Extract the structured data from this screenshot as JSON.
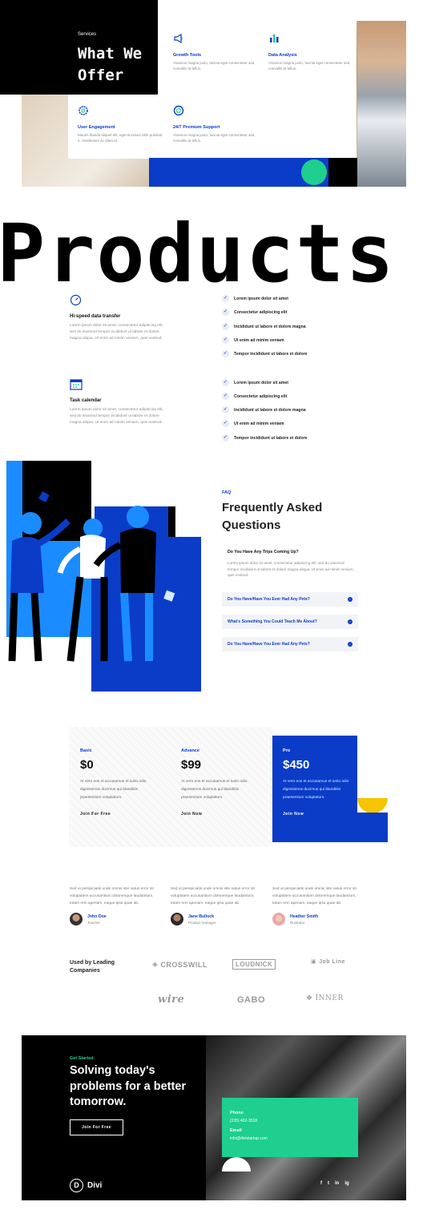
{
  "services": {
    "label": "Services",
    "title_line1": "What We",
    "title_line2": "Offer",
    "features": [
      {
        "title": "Growth Tools",
        "text": "Vivamus magna justo, lacinia eget consectetur sed, convallis at tellus.",
        "icon": "megaphone-icon"
      },
      {
        "title": "Data Analysis",
        "text": "Vivamus magna justo, lacinia eget consectetur sed, convallis at tellus.",
        "icon": "bar-chart-icon"
      },
      {
        "title": "User Engagement",
        "text": "Mauris blandit aliquet elit, eget tincidunt nibh pulvinar a. Vestibulum ac diam et.",
        "icon": "gear-icon"
      },
      {
        "title": "24/7 Premium Support",
        "text": "Vivamus magna justo, lacinia eget consectetur sed, convallis at tellus.",
        "icon": "lifebuoy-icon"
      }
    ]
  },
  "products": {
    "heading": "Products",
    "features": [
      {
        "title": "Hi-speed data transfer",
        "text": "Lorem ipsum dolor sit amet, consectetur adipiscing elit, sed do eiusmod tempor incididunt ut labore et dolore magna aliqua. Ut enim ad minim veniam, quis nostrud.",
        "icon": "speedometer-icon"
      },
      {
        "title": "Task calendar",
        "text": "Lorem ipsum dolor sit amet, consectetur adipiscing elit, sed do eiusmod tempor incididunt ut labore et dolore magna aliqua. Ut enim ad minim veniam, quis nostrud.",
        "icon": "calendar-icon"
      }
    ],
    "checklist_1": [
      "Lorem ipsum dolor sit amet",
      "Consectetur adipiscing elit",
      "Incididunt ut labore et dolore magna",
      "Ut enim ad minim veniam",
      "Tempor incididunt ut labore et dolore"
    ],
    "checklist_2": [
      "Lorem ipsum dolor sit amet",
      "Consectetur adipiscing elit",
      "Incididunt ut labore et dolore magna",
      "Ut enim ad minim veniam",
      "Tempor incididunt ut labore et dolore"
    ]
  },
  "faq": {
    "label": "FAQ",
    "title": "Frequently Asked Questions",
    "open_question": "Do You Have Any Trips Coming Up?",
    "open_answer": "Lorem ipsum dolor sit amet, consectetur adipiscing elit, sed do eiusmod tempor incididunt ut labore et dolore magna aliqua. Ut enim ad minim veniam, quis nostrud.",
    "items": [
      "Do You Have/Have You Ever Had Any Pets?",
      "What's Something You Could Teach Me About?",
      "Do You Have/Have You Ever Had Any Pets?"
    ]
  },
  "pricing": [
    {
      "name": "Basic",
      "price": "$0",
      "desc": "At vero eos et accusamus et iusto odio dignissimos ducimus qui blanditiis praesentium voluptatum.",
      "cta": "Join For Free"
    },
    {
      "name": "Advance",
      "price": "$99",
      "desc": "At vero eos et accusamus et iusto odio dignissimos ducimus qui blanditiis praesentium voluptatum.",
      "cta": "Join Now"
    },
    {
      "name": "Pro",
      "price": "$450",
      "desc": "At vero eos et accusamus et iusto odio dignissimos ducimus qui blanditiis praesentium voluptatum.",
      "cta": "Join Now"
    }
  ],
  "testimonials": [
    {
      "text": "Sed ut perspiciatis unde omnis iste natus error sit voluptatem accusantium doloremque laudantium, totam rem aperiam, eaque ipsa quae ab.",
      "name": "John Doe",
      "role": "Teacher"
    },
    {
      "text": "Sed ut perspiciatis unde omnis iste natus error sit voluptatem accusantium doloremque laudantium, totam rem aperiam, eaque ipsa quae ab.",
      "name": "Jane Bullock",
      "role": "Product manager"
    },
    {
      "text": "Sed ut perspiciatis unde omnis iste natus error sit voluptatem accusantium doloremque laudantium, totam rem aperiam, eaque ipsa quae ab.",
      "name": "Heather Smith",
      "role": "Illustrator"
    }
  ],
  "logos": {
    "heading": "Used by Leading Companies",
    "names": [
      "CROSSWILL",
      "LOUDNICK",
      "Job Line",
      "wire",
      "GABO",
      "INNER"
    ]
  },
  "cta": {
    "label": "Get Started",
    "title": "Solving today's problems for a better tomorrow.",
    "button": "Join For Free"
  },
  "contact": {
    "phone_label": "Phone",
    "phone": "(235) 462-3518",
    "email_label": "Email",
    "email": "info@divistartup.com"
  },
  "footer": {
    "brand": "Divi",
    "brand_initial": "D",
    "social": [
      "f",
      "t",
      "in",
      "ig"
    ]
  },
  "colors": {
    "accent": "#0a3cc8",
    "green": "#1ecf8e",
    "yellow": "#f6c400"
  }
}
